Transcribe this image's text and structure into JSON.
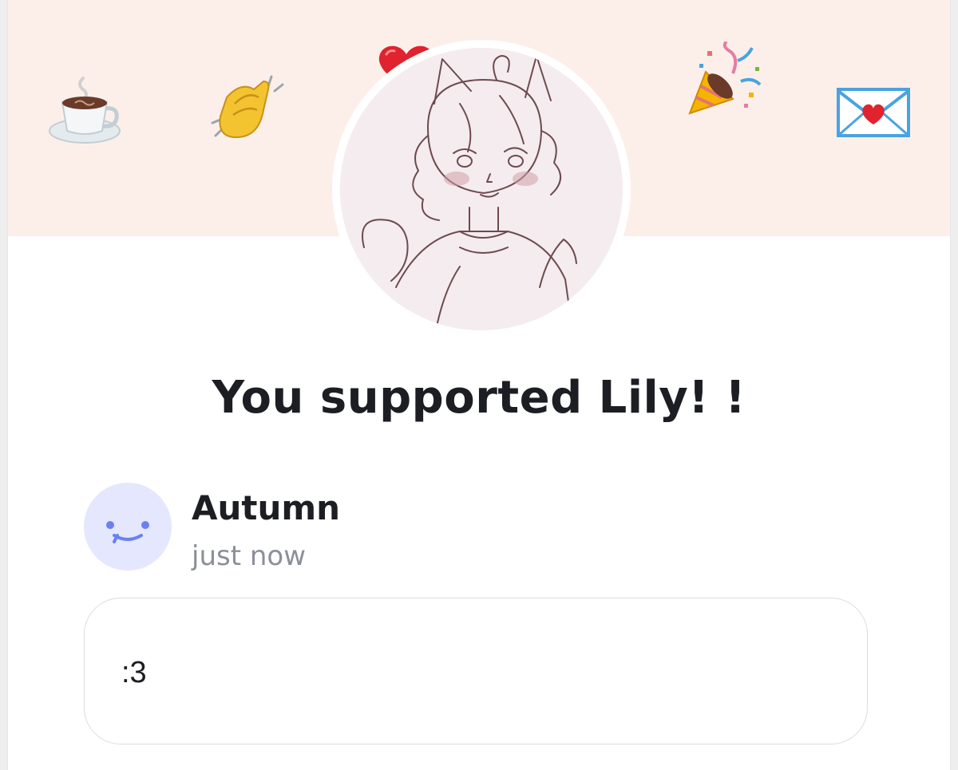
{
  "banner": {
    "emojis": [
      "coffee-icon",
      "clapping-hands-icon",
      "heart-icon",
      "party-popper-icon",
      "love-letter-icon"
    ],
    "background": "#fcefea"
  },
  "creator": {
    "avatar": "creator-avatar-sketch"
  },
  "headline": "You supported Lily! !",
  "supporter": {
    "name": "Autumn",
    "time": "just now",
    "avatar_color": "#e4e7fd",
    "avatar_face_color": "#6b80f0"
  },
  "message": {
    "text": ":3"
  }
}
